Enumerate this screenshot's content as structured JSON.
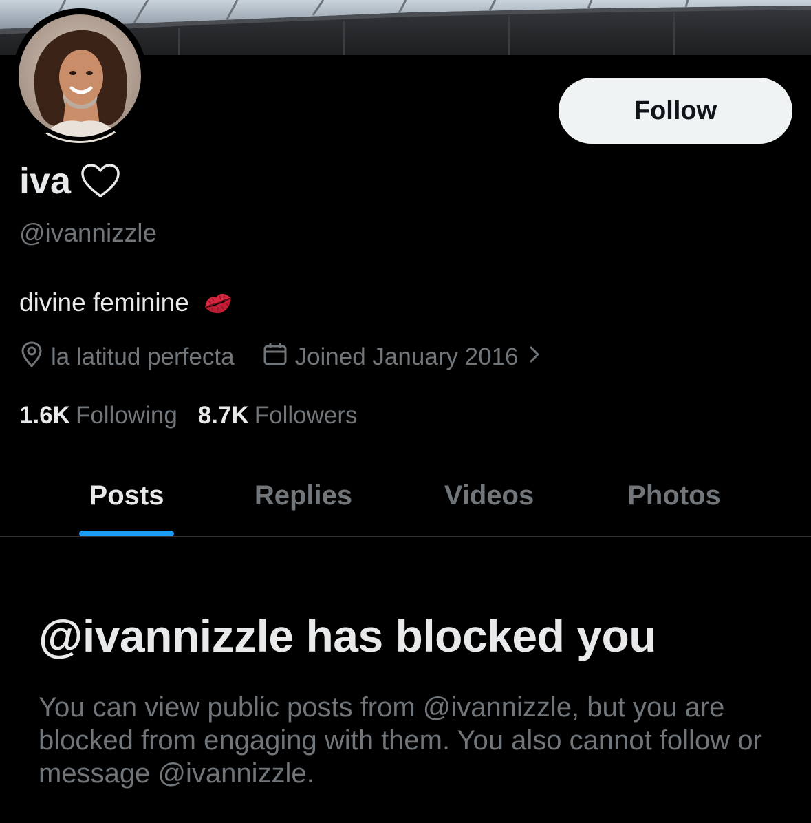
{
  "profile": {
    "display_name": "iva",
    "handle": "@ivannizzle",
    "bio": "divine feminine",
    "bio_emoji": "lips-kiss-icon",
    "location": "la latitud perfecta",
    "joined": "Joined January 2016",
    "following_count": "1.6K",
    "following_label": "Following",
    "followers_count": "8.7K",
    "followers_label": "Followers"
  },
  "actions": {
    "follow_label": "Follow"
  },
  "tabs": [
    {
      "label": "Posts",
      "active": true
    },
    {
      "label": "Replies",
      "active": false
    },
    {
      "label": "Videos",
      "active": false
    },
    {
      "label": "Photos",
      "active": false
    }
  ],
  "blocked": {
    "title": "@ivannizzle has blocked you",
    "message": "You can view public posts from @ivannizzle, but you are blocked from engaging with them. You also cannot follow or message @ivannizzle."
  },
  "colors": {
    "background": "#000000",
    "primary_text": "#e7e9ea",
    "secondary_text": "#71767b",
    "accent": "#1d9bf0",
    "follow_button_bg": "#eff3f4"
  }
}
